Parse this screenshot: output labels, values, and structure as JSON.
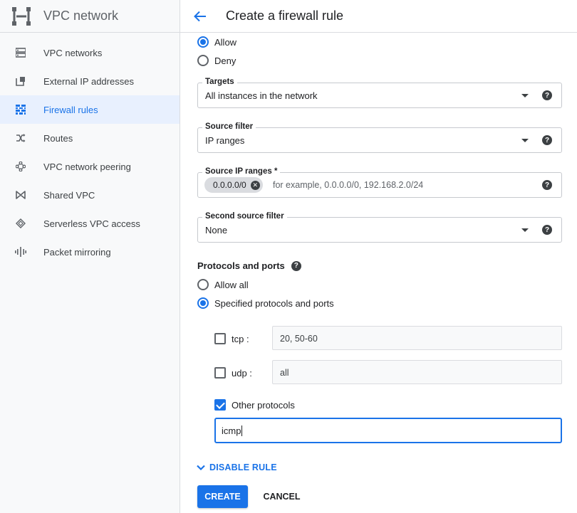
{
  "sidebar": {
    "title": "VPC network",
    "items": [
      {
        "label": "VPC networks",
        "icon": "vpc-networks-icon"
      },
      {
        "label": "External IP addresses",
        "icon": "external-ip-icon"
      },
      {
        "label": "Firewall rules",
        "icon": "firewall-icon",
        "active": true
      },
      {
        "label": "Routes",
        "icon": "routes-icon"
      },
      {
        "label": "VPC network peering",
        "icon": "peering-icon"
      },
      {
        "label": "Shared VPC",
        "icon": "shared-vpc-icon"
      },
      {
        "label": "Serverless VPC access",
        "icon": "serverless-icon"
      },
      {
        "label": "Packet mirroring",
        "icon": "packet-mirroring-icon"
      }
    ]
  },
  "header": {
    "title": "Create a firewall rule"
  },
  "action": {
    "allow_label": "Allow",
    "deny_label": "Deny",
    "selected": "Allow"
  },
  "targets": {
    "label": "Targets",
    "value": "All instances in the network"
  },
  "source_filter": {
    "label": "Source filter",
    "value": "IP ranges"
  },
  "source_ip_ranges": {
    "label": "Source IP ranges *",
    "chip": "0.0.0.0/0",
    "placeholder": "for example, 0.0.0.0/0, 192.168.2.0/24"
  },
  "second_source_filter": {
    "label": "Second source filter",
    "value": "None"
  },
  "protocols": {
    "title": "Protocols and ports",
    "allow_all_label": "Allow all",
    "specified_label": "Specified protocols and ports",
    "selected": "Specified protocols and ports",
    "tcp": {
      "label": "tcp :",
      "value": "20, 50-60",
      "checked": false
    },
    "udp": {
      "label": "udp :",
      "value": "all",
      "checked": false
    },
    "other": {
      "label": "Other protocols",
      "value": "icmp",
      "checked": true
    }
  },
  "disable_rule_label": "DISABLE RULE",
  "buttons": {
    "create": "CREATE",
    "cancel": "CANCEL"
  },
  "colors": {
    "accent": "#1a73e8",
    "active_bg": "#e8f0fe"
  }
}
